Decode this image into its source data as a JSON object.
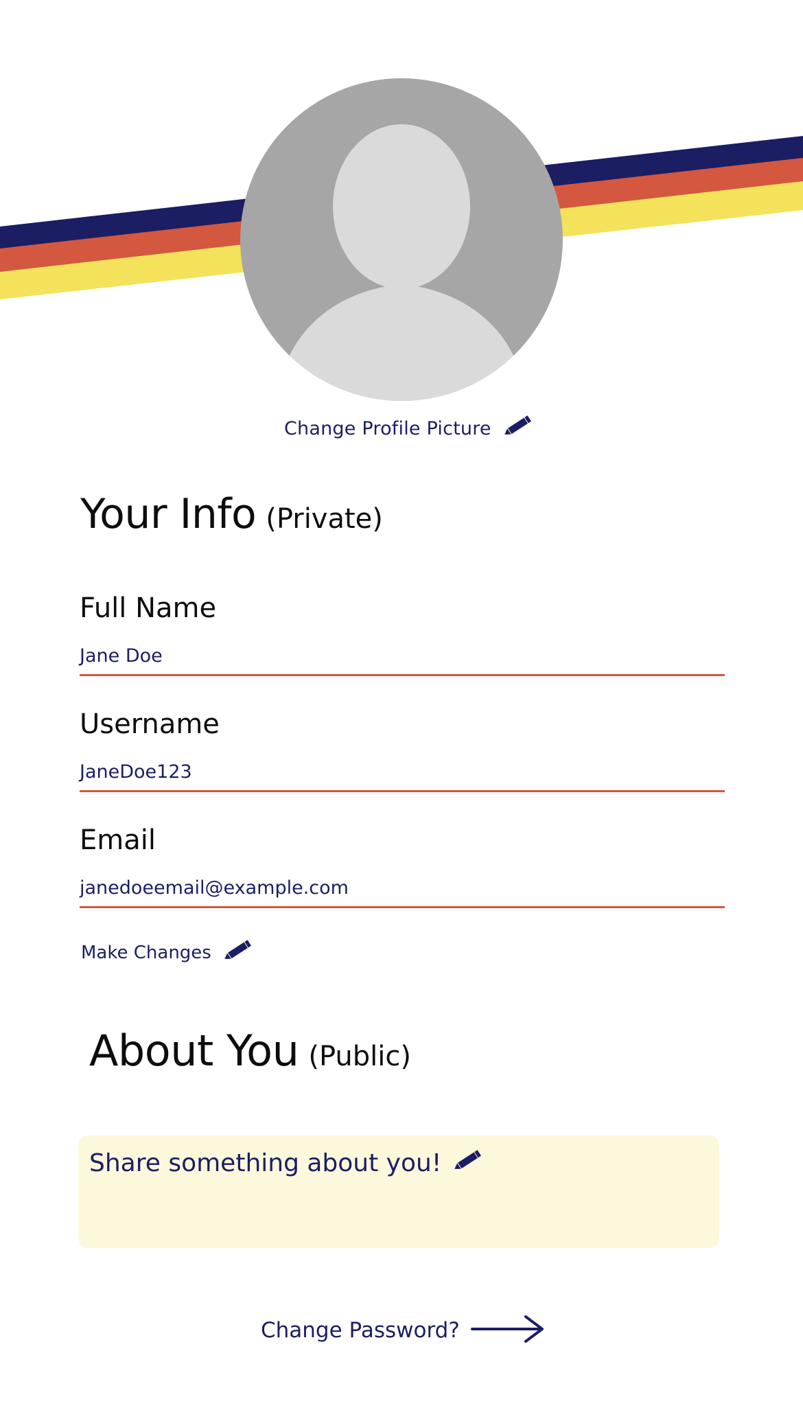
{
  "profile": {
    "change_picture_label": "Change Profile Picture"
  },
  "info": {
    "title": "Your Info",
    "privacy": "(Private)",
    "fields": [
      {
        "label": "Full Name",
        "value": "Jane Doe"
      },
      {
        "label": "Username",
        "value": "JaneDoe123"
      },
      {
        "label": "Email",
        "value": "janedoeemail@example.com"
      }
    ],
    "make_changes_label": "Make Changes"
  },
  "about": {
    "title": "About You",
    "privacy": "(Public)",
    "placeholder": "Share something about you!"
  },
  "footer": {
    "change_password_label": "Change Password?"
  },
  "colors": {
    "navy": "#1b1e63",
    "orange": "#d4573f",
    "yellow": "#f4e25a",
    "about_box_bg": "#fcf8dc",
    "avatar_bg": "#a6a6a6",
    "avatar_figure": "#dadada"
  },
  "icons": {
    "edit": "pencil-icon",
    "arrow": "arrow-right-icon",
    "avatar": "user-placeholder"
  }
}
